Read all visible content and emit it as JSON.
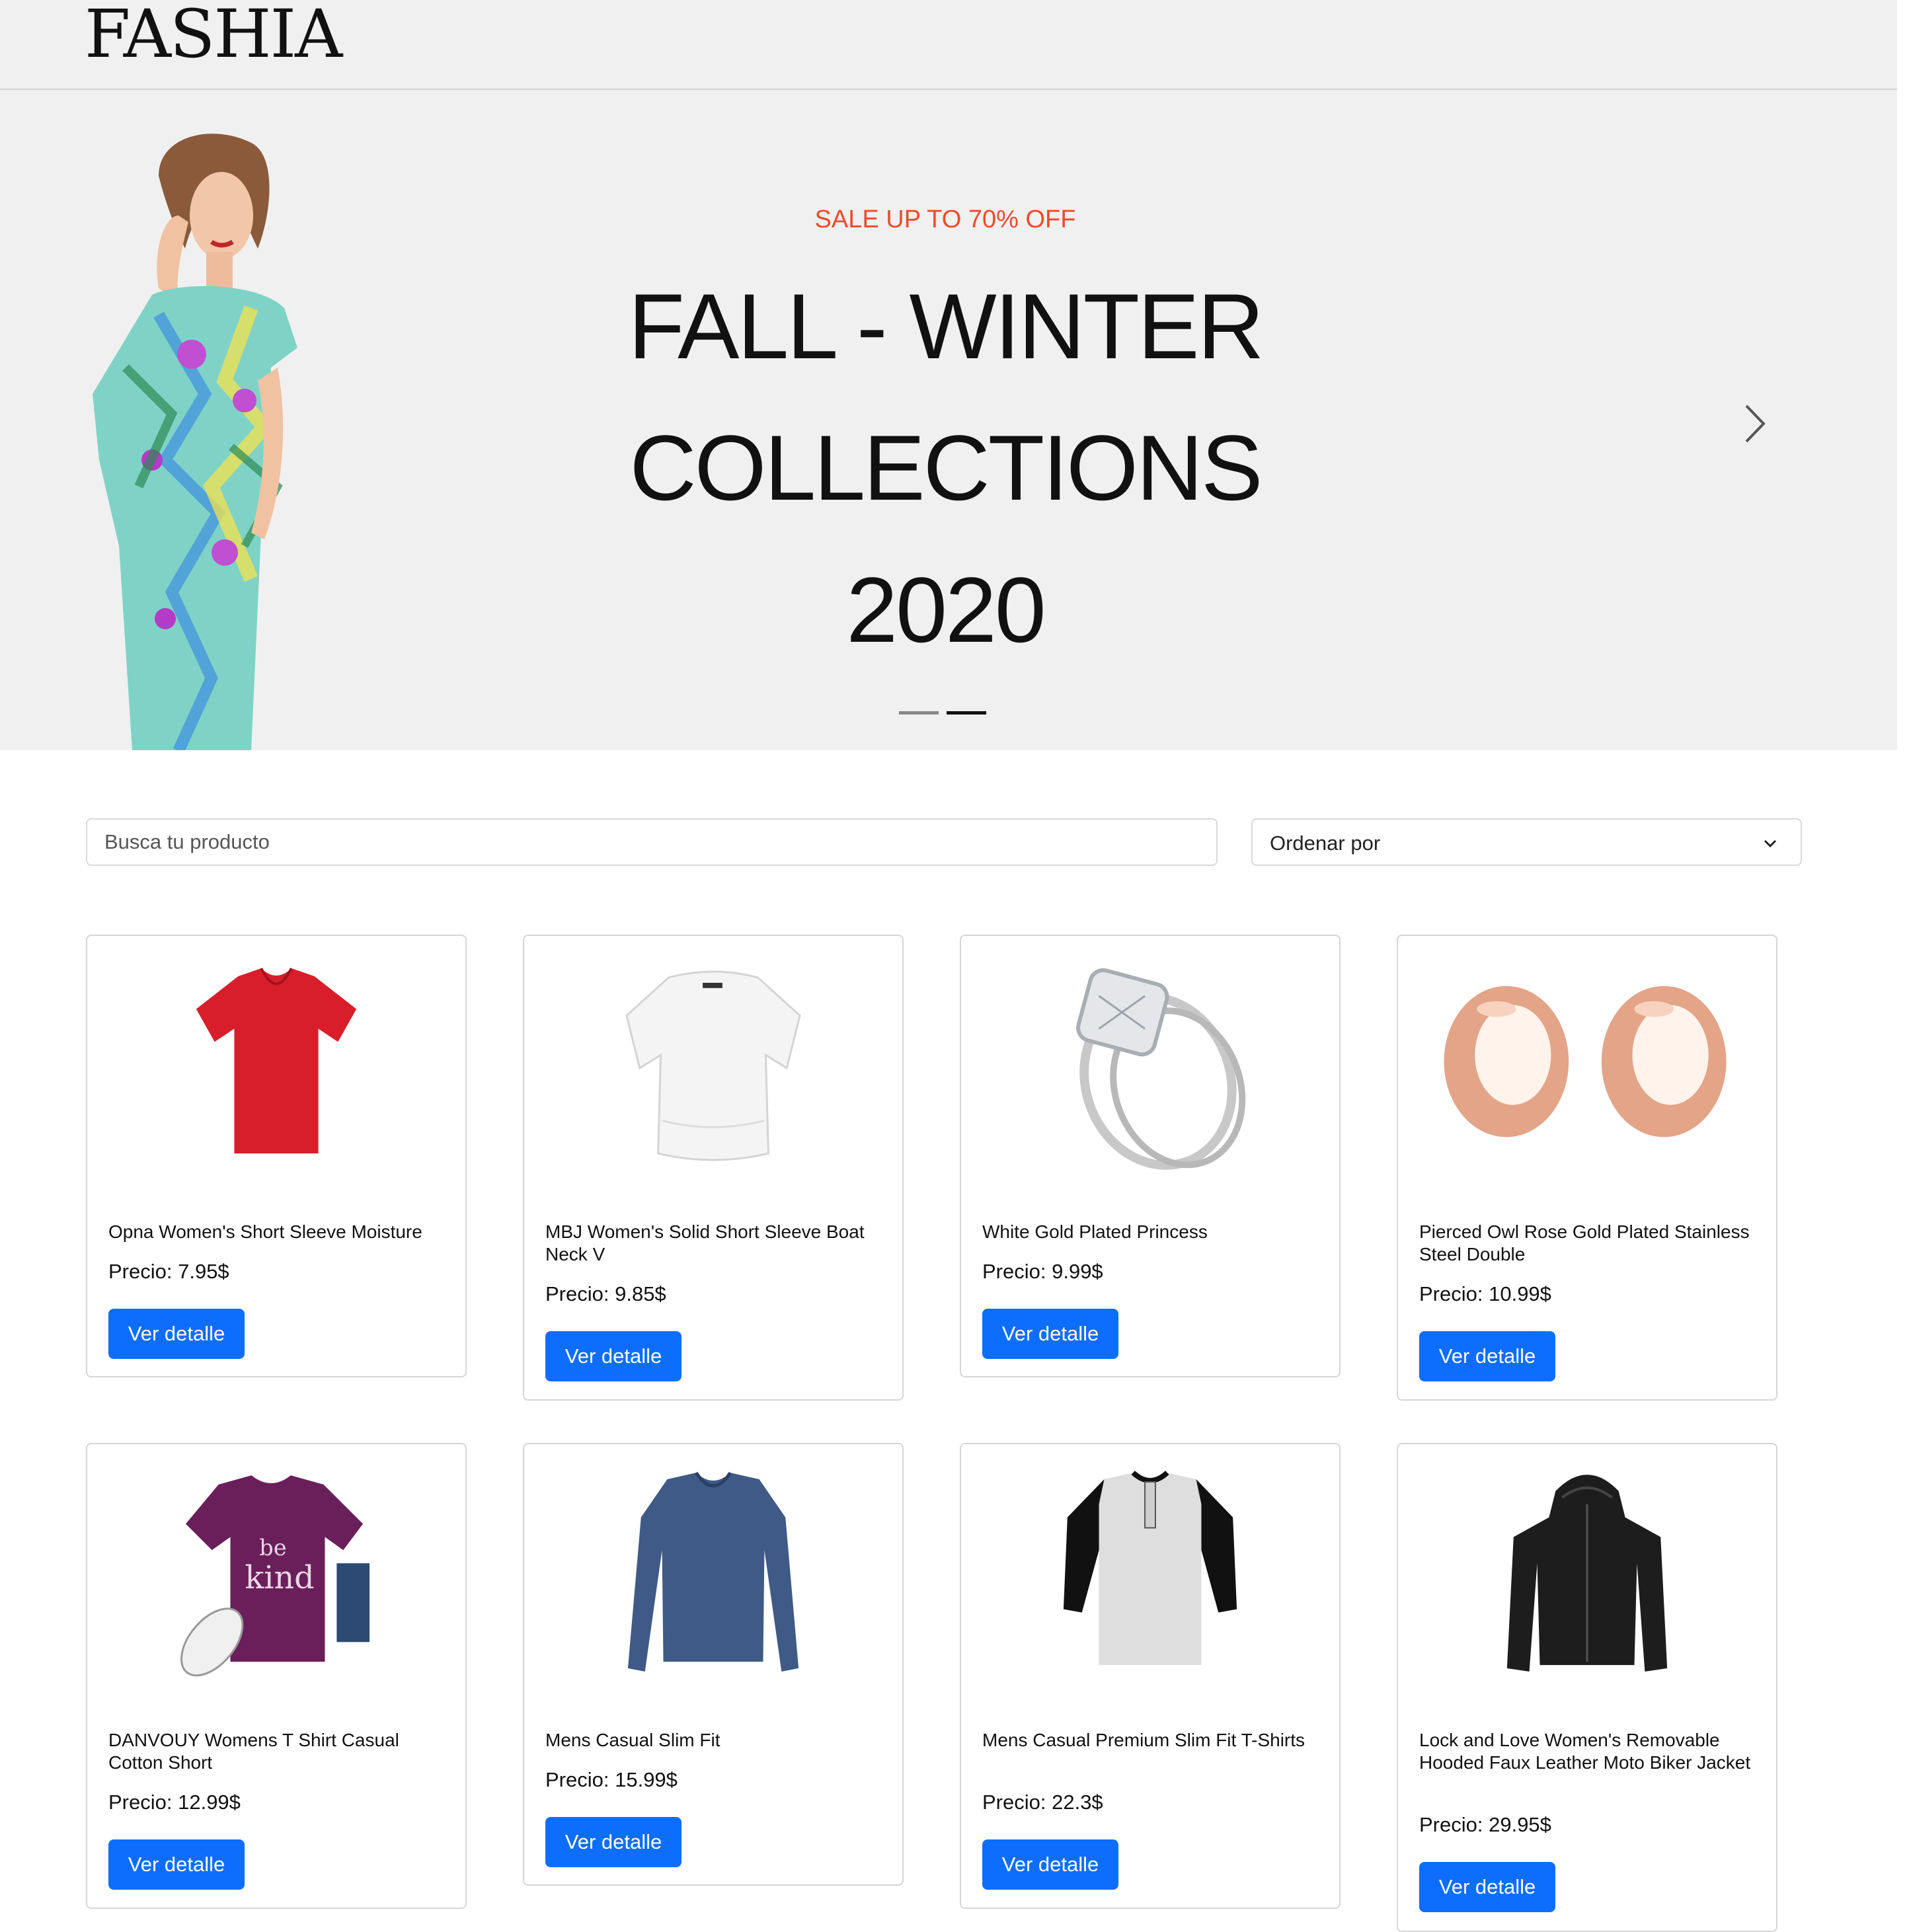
{
  "header": {
    "logo": "FASHIA"
  },
  "hero": {
    "sale_text": "SALE UP TO 70% OFF",
    "title_lines": [
      "FALL - WINTER",
      "COLLECTIONS",
      "2020"
    ],
    "next_icon": "chevron-right-icon",
    "carousel_active_index": 2,
    "carousel_count": 2
  },
  "toolbar": {
    "search_placeholder": "Busca tu producto",
    "sort_label": "Ordenar por"
  },
  "products": [
    {
      "name": "Opna Women's Short Sleeve Moisture",
      "price": "Precio: 7.95$",
      "button": "Ver detalle"
    },
    {
      "name": "MBJ Women's Solid Short Sleeve Boat Neck V",
      "price": "Precio: 9.85$",
      "button": "Ver detalle"
    },
    {
      "name": "White Gold Plated Princess",
      "price": "Precio: 9.99$",
      "button": "Ver detalle"
    },
    {
      "name": "Pierced Owl Rose Gold Plated Stainless Steel Double",
      "price": "Precio: 10.99$",
      "button": "Ver detalle"
    },
    {
      "name": "DANVOUY Womens T Shirt Casual Cotton Short",
      "price": "Precio: 12.99$",
      "button": "Ver detalle"
    },
    {
      "name": "Mens Casual Slim Fit",
      "price": "Precio: 15.99$",
      "button": "Ver detalle"
    },
    {
      "name": "Mens Casual Premium Slim Fit T-Shirts",
      "price": "Precio: 22.3$",
      "button": "Ver detalle"
    },
    {
      "name": "Lock and Love Women's Removable Hooded Faux Leather Moto Biker Jacket",
      "price": "Precio: 29.95$",
      "button": "Ver detalle"
    }
  ],
  "colors": {
    "accent": "#0d6efd",
    "sale": "#ea4c2c",
    "hero_bg": "#f0f0f0"
  }
}
